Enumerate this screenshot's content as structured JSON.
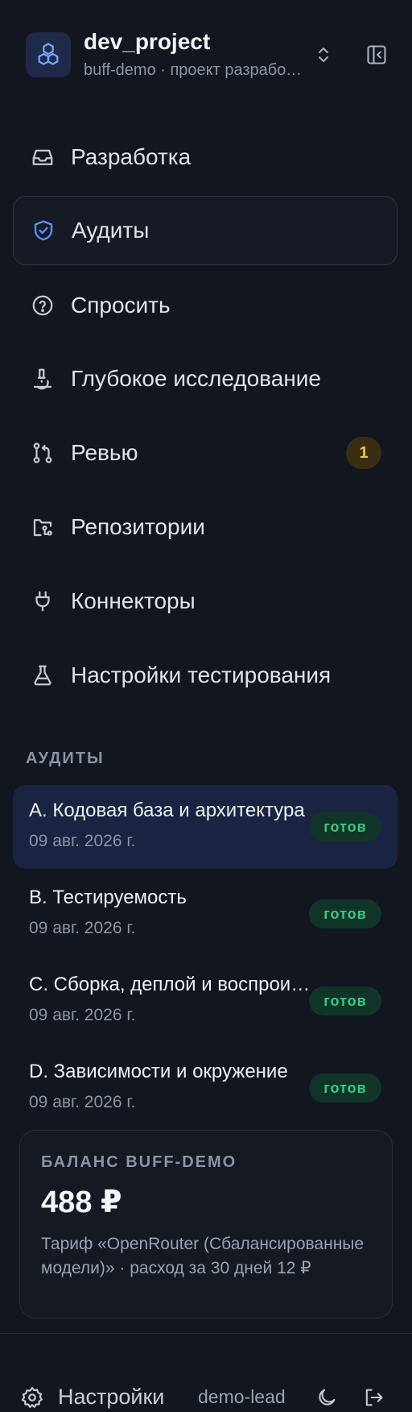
{
  "header": {
    "project_name": "dev_project",
    "project_subtitle": "buff-demo · проект разработки",
    "logo_icon": "cubes-icon",
    "switch_icon": "chevron-up-down-icon",
    "collapse_icon": "sidebar-collapse-icon"
  },
  "nav": {
    "items": [
      {
        "label": "Разработка",
        "icon": "inbox-icon"
      },
      {
        "label": "Аудиты",
        "icon": "shield-check-icon",
        "active": true
      },
      {
        "label": "Спросить",
        "icon": "question-circle-icon"
      },
      {
        "label": "Глубокое исследование",
        "icon": "microscope-icon"
      },
      {
        "label": "Ревью",
        "icon": "git-pull-request-icon",
        "badge": "1"
      },
      {
        "label": "Репозитории",
        "icon": "folder-git-icon"
      },
      {
        "label": "Коннекторы",
        "icon": "plug-icon"
      },
      {
        "label": "Настройки тестирования",
        "icon": "flask-icon"
      }
    ]
  },
  "audits": {
    "section_title": "АУДИТЫ",
    "items": [
      {
        "title": "A. Кодовая база и архитектура",
        "date": "09 авг. 2026 г.",
        "status": "готов",
        "active": true
      },
      {
        "title": "B. Тестируемость",
        "date": "09 авг. 2026 г.",
        "status": "готов"
      },
      {
        "title": "C. Сборка, деплой и воспроизводимость",
        "date": "09 авг. 2026 г.",
        "status": "готов"
      },
      {
        "title": "D. Зависимости и окружение",
        "date": "09 авг. 2026 г.",
        "status": "готов"
      }
    ]
  },
  "balance": {
    "title": "БАЛАНС BUFF-DEMO",
    "amount": "488 ₽",
    "description": "Тариф «OpenRouter (Сбалансированные модели)» · расход за 30 дней 12 ₽"
  },
  "footer": {
    "settings_label": "Настройки",
    "username": "demo-lead",
    "settings_icon": "gear-icon",
    "theme_icon": "moon-icon",
    "logout_icon": "logout-icon"
  },
  "colors": {
    "background": "#12161f",
    "accent": "#5b8cff",
    "status_ready": "#35c98a",
    "badge": "#f5c23c"
  }
}
